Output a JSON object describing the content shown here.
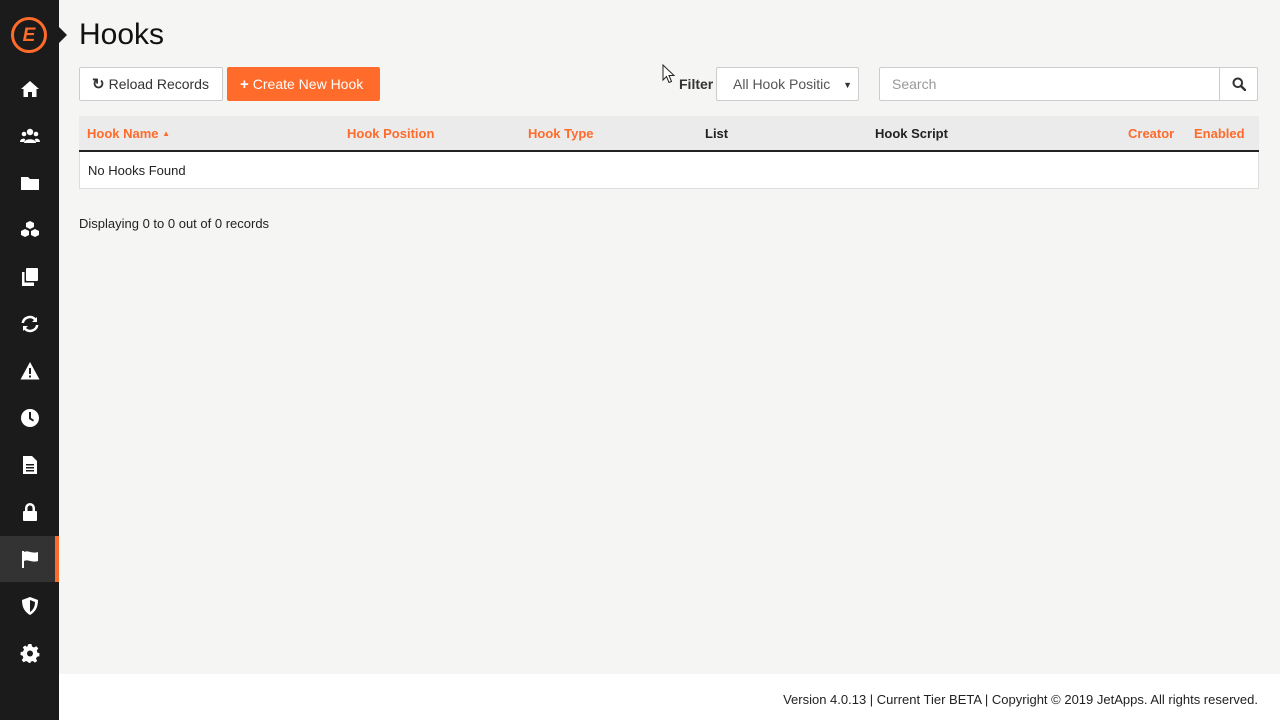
{
  "app": {
    "page_title": "Hooks"
  },
  "sidebar": {
    "logo_letter": "E",
    "items": [
      {
        "icon": "home-icon",
        "active": false
      },
      {
        "icon": "users-icon",
        "active": false
      },
      {
        "icon": "folder-icon",
        "active": false
      },
      {
        "icon": "cubes-icon",
        "active": false
      },
      {
        "icon": "copy-icon",
        "active": false
      },
      {
        "icon": "refresh-icon",
        "active": false
      },
      {
        "icon": "warning-icon",
        "active": false
      },
      {
        "icon": "clock-icon",
        "active": false
      },
      {
        "icon": "file-icon",
        "active": false
      },
      {
        "icon": "lock-icon",
        "active": false
      },
      {
        "icon": "flag-icon",
        "active": true
      },
      {
        "icon": "shield-icon",
        "active": false
      },
      {
        "icon": "gear-icon",
        "active": false
      }
    ],
    "accent_color": "#ff6b2b"
  },
  "toolbar": {
    "reload_icon": "↻",
    "reload_label": "Reload Records",
    "create_icon": "+",
    "create_label": "Create New Hook",
    "filter_label": "Filter",
    "filter_value": "All Hook Positic",
    "search_placeholder": "Search"
  },
  "table": {
    "columns": [
      {
        "label": "Hook Name",
        "sortable": true,
        "sorted": "asc"
      },
      {
        "label": "Hook Position",
        "sortable": true
      },
      {
        "label": "Hook Type",
        "sortable": true
      },
      {
        "label": "List",
        "sortable": false
      },
      {
        "label": "Hook Script",
        "sortable": false
      },
      {
        "label": "Creator",
        "sortable": true
      },
      {
        "label": "Enabled",
        "sortable": true
      }
    ],
    "sort_indicator": "▲",
    "empty_message": "No Hooks Found"
  },
  "pagination": {
    "summary": "Displaying 0 to 0 out of 0 records"
  },
  "footer": {
    "text": "Version 4.0.13 | Current Tier BETA | Copyright © 2019 JetApps. All rights reserved."
  }
}
